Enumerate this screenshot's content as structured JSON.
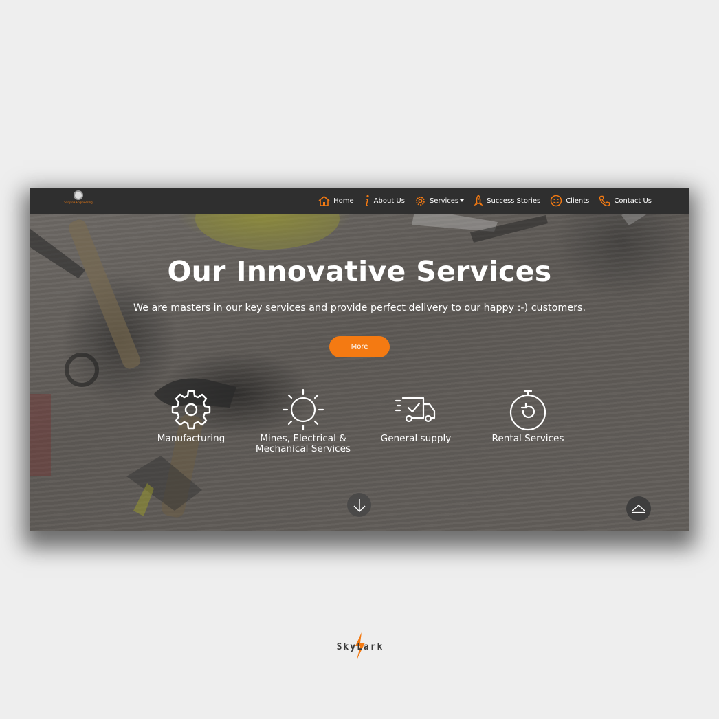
{
  "nav": {
    "logo_text": "Sanjana Engineering",
    "items": [
      {
        "label": "Home",
        "icon": "home-icon"
      },
      {
        "label": "About Us",
        "icon": "info-icon"
      },
      {
        "label": "Services",
        "icon": "gear-icon",
        "has_dropdown": true
      },
      {
        "label": "Success Stories",
        "icon": "rocket-icon"
      },
      {
        "label": "Clients",
        "icon": "smile-icon"
      },
      {
        "label": "Contact Us",
        "icon": "phone-icon"
      }
    ]
  },
  "hero": {
    "title": "Our Innovative Services",
    "subtitle": "We are masters in our key services and provide perfect delivery to our happy :-) customers.",
    "button_label": "More"
  },
  "services": [
    {
      "label": "Manufacturing",
      "icon": "gear-icon"
    },
    {
      "label": "Mines, Electrical & Mechanical Services",
      "icon": "sun-icon"
    },
    {
      "label": "General supply",
      "icon": "delivery-truck-icon"
    },
    {
      "label": "Rental Services",
      "icon": "timer-icon"
    }
  ],
  "controls": {
    "scroll_down_icon": "arrow-down-icon",
    "to_top_icon": "chevron-up-icon"
  },
  "brand": {
    "text": "SkyLark"
  },
  "colors": {
    "accent": "#f47a12",
    "navbar": "#2f2f2f",
    "page_bg": "#eeeeee"
  }
}
